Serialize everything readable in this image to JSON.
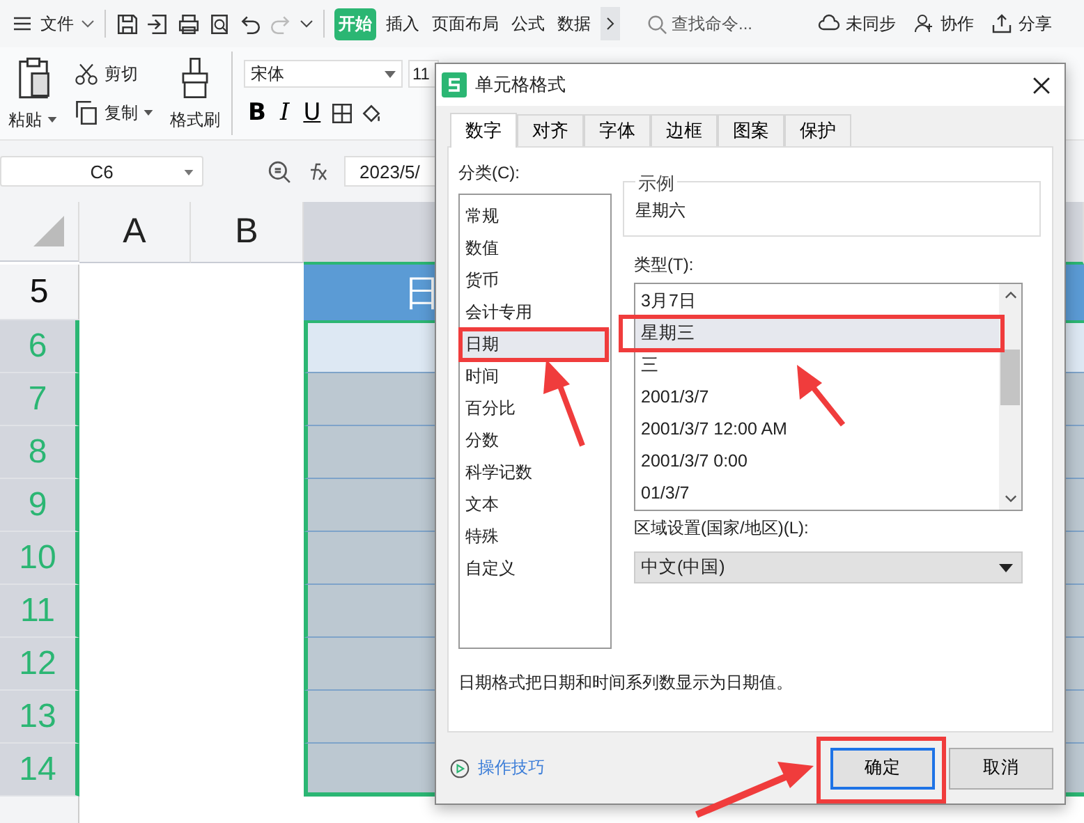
{
  "menu_bar": {
    "file_menu": "文件",
    "tabs": [
      {
        "label": "开始",
        "selected": true
      },
      {
        "label": "插入",
        "selected": false
      },
      {
        "label": "页面布局",
        "selected": false
      },
      {
        "label": "公式",
        "selected": false
      },
      {
        "label": "数据",
        "selected": false
      }
    ],
    "search": {
      "placeholder": "查找命令..."
    },
    "actions": [
      "未同步",
      "协作",
      "分享"
    ]
  },
  "ribbon": {
    "paste": "粘贴",
    "cut": "剪切",
    "copy": "复制",
    "format_painter": "格式刷",
    "font_name": "宋体",
    "font_size": "11",
    "format_buttons": [
      "B",
      "I",
      "U"
    ]
  },
  "formula_bar": {
    "name_box": "C6",
    "formula": "2023/5/"
  },
  "sheet": {
    "columns": [
      "A",
      "B"
    ],
    "header_text": "日",
    "rows": [
      {
        "number": "5",
        "selected": false
      },
      {
        "number": "6",
        "selected": true
      },
      {
        "number": "7",
        "selected": true
      },
      {
        "number": "8",
        "selected": true
      },
      {
        "number": "9",
        "selected": true
      },
      {
        "number": "10",
        "selected": true
      },
      {
        "number": "11",
        "selected": true
      },
      {
        "number": "12",
        "selected": true
      },
      {
        "number": "13",
        "selected": true
      },
      {
        "number": "14",
        "selected": true
      }
    ]
  },
  "dialog": {
    "title": "单元格格式",
    "tabs": [
      {
        "label": "数字",
        "selected": true
      },
      {
        "label": "对齐",
        "selected": false
      },
      {
        "label": "字体",
        "selected": false
      },
      {
        "label": "边框",
        "selected": false
      },
      {
        "label": "图案",
        "selected": false
      },
      {
        "label": "保护",
        "selected": false
      }
    ],
    "category_label": "分类(C):",
    "categories": [
      {
        "label": "常规",
        "selected": false
      },
      {
        "label": "数值",
        "selected": false
      },
      {
        "label": "货币",
        "selected": false
      },
      {
        "label": "会计专用",
        "selected": false
      },
      {
        "label": "日期",
        "selected": true
      },
      {
        "label": "时间",
        "selected": false
      },
      {
        "label": "百分比",
        "selected": false
      },
      {
        "label": "分数",
        "selected": false
      },
      {
        "label": "科学记数",
        "selected": false
      },
      {
        "label": "文本",
        "selected": false
      },
      {
        "label": "特殊",
        "selected": false
      },
      {
        "label": "自定义",
        "selected": false
      }
    ],
    "sample": {
      "label": "示例",
      "value": "星期六"
    },
    "type_label": "类型(T):",
    "types": [
      {
        "label": "3月7日",
        "selected": false
      },
      {
        "label": "星期三",
        "selected": true
      },
      {
        "label": "三",
        "selected": false
      },
      {
        "label": "2001/3/7",
        "selected": false
      },
      {
        "label": "2001/3/7 12:00 AM",
        "selected": false
      },
      {
        "label": "2001/3/7 0:00",
        "selected": false
      },
      {
        "label": "01/3/7",
        "selected": false
      }
    ],
    "locale_label": "区域设置(国家/地区)(L):",
    "locale": "中文(中国)",
    "description": "日期格式把日期和时间系列数显示为日期值。",
    "tips_link": "操作技巧",
    "ok_button": "确定",
    "cancel_button": "取消"
  }
}
